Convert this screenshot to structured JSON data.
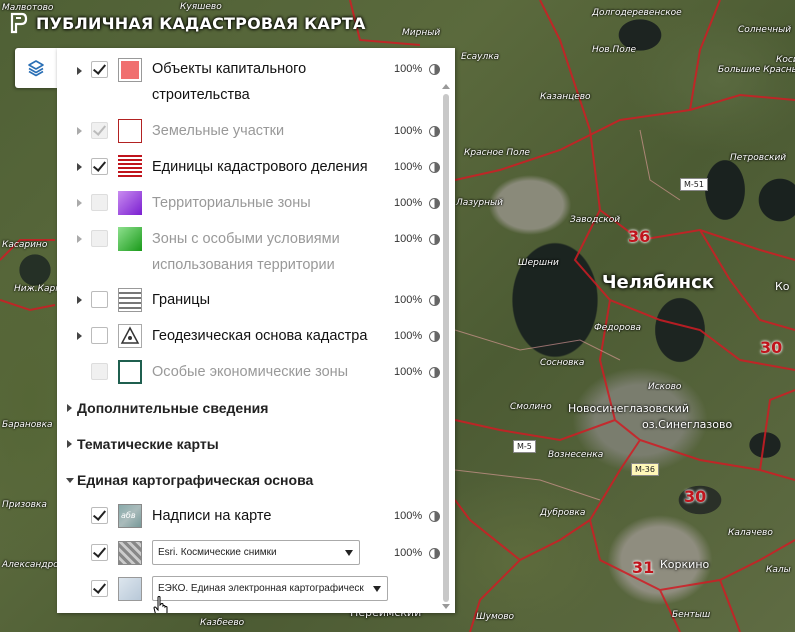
{
  "app": {
    "title": "ПУБЛИЧНАЯ КАДАСТРОВАЯ КАРТА"
  },
  "layers_panel": {
    "layers": [
      {
        "label_line1": "Объекты капитального",
        "label_line2": "строительства",
        "opacity": "100%",
        "checked": true,
        "enabled": true,
        "icon": "capital-construction-icon",
        "color": "#f07070"
      },
      {
        "label": "Земельные участки",
        "opacity": "100%",
        "checked": true,
        "enabled": false,
        "icon": "land-plots-icon",
        "color": "#b22222"
      },
      {
        "label": "Единицы кадастрового деления",
        "opacity": "100%",
        "checked": true,
        "enabled": true,
        "icon": "cadastral-division-icon",
        "color": "#c0141c"
      },
      {
        "label": "Территориальные зоны",
        "opacity": "100%",
        "checked": false,
        "enabled": false,
        "icon": "territorial-zones-icon",
        "color": "#9b30d9"
      },
      {
        "label_line1": "Зоны с особыми условиями",
        "label_line2": "использования территории",
        "opacity": "100%",
        "checked": false,
        "enabled": false,
        "icon": "special-zones-icon",
        "color": "#2ca02c"
      },
      {
        "label": "Границы",
        "opacity": "100%",
        "checked": false,
        "enabled": true,
        "icon": "borders-icon"
      },
      {
        "label": "Геодезическая основа кадастра",
        "opacity": "100%",
        "checked": false,
        "enabled": true,
        "icon": "geodetic-icon"
      },
      {
        "label": "Особые экономические зоны",
        "opacity": "100%",
        "checked": false,
        "enabled": false,
        "icon": "economic-zones-icon",
        "color": "#1f5f4f"
      }
    ],
    "sections": {
      "additional": "Дополнительные сведения",
      "thematic": "Тематические карты",
      "basemap": "Единая картографическая основа"
    },
    "basemap_layers": [
      {
        "label": "Надписи на карте",
        "opacity": "100%",
        "checked": true,
        "icon": "map-labels-icon",
        "icon_text": "абв"
      },
      {
        "select_value": "Esri. Космические снимки",
        "opacity": "100%",
        "checked": true,
        "icon": "satellite-icon"
      },
      {
        "select_value": "ЕЭКО. Единая электронная картографическ",
        "checked": true,
        "icon": "ekoo-map-icon"
      }
    ]
  },
  "map": {
    "labels": {
      "malvotovo": "Малвотово",
      "kuyashevo": "Куяшево",
      "mirny": "Мирный",
      "esaulka": "Есаулка",
      "kazantsevo": "Казанцево",
      "krasnoe_pole": "Красное Поле",
      "novoe_pole": "Нов.Поле",
      "dolgoderevenskoe": "Долгодеревенское",
      "solnechny": "Солнечный",
      "bolshiye_krasny": "Большие Красны",
      "petrovskiy": "Петровский",
      "lazurny": "Лазурный",
      "zavodskoy": "Заводской",
      "shershni": "Шершни",
      "fedorovka": "Федорова",
      "sosnovka": "Сосновка",
      "iskovo": "Исково",
      "smolino": "Смолино",
      "voznesenka": "Вознесенка",
      "dubrovka": "Дубровка",
      "kalachevo": "Калачево",
      "shumovo": "Шумово",
      "kazbeevo": "Казбеево",
      "pereymskiy": "Переймский",
      "bentyy": "Бентыш",
      "kosino": "Косино",
      "kasarino": "Касарино",
      "nizh_karp": "Ниж.Карп",
      "baranovka": "Барановка",
      "chelyabinsk": "Челябинск",
      "novosineglazovsky": "Новосинеглазовский",
      "oz_sineglazovo": "оз.Синеглазово",
      "korkino": "Коркино",
      "ko": "Ко",
      "aleksandrovka": "Александровка",
      "kaly": "Калы",
      "prizovka": "Призовка"
    },
    "roads": {
      "m51": "М-51",
      "m5": "М-5",
      "m36": "М-36"
    },
    "zones": {
      "z36": "36",
      "z30a": "30",
      "z30b": "30",
      "z31": "31"
    }
  },
  "colors": {
    "accent_blue": "#2a6fb5",
    "cadastral_red": "#c0141c"
  }
}
